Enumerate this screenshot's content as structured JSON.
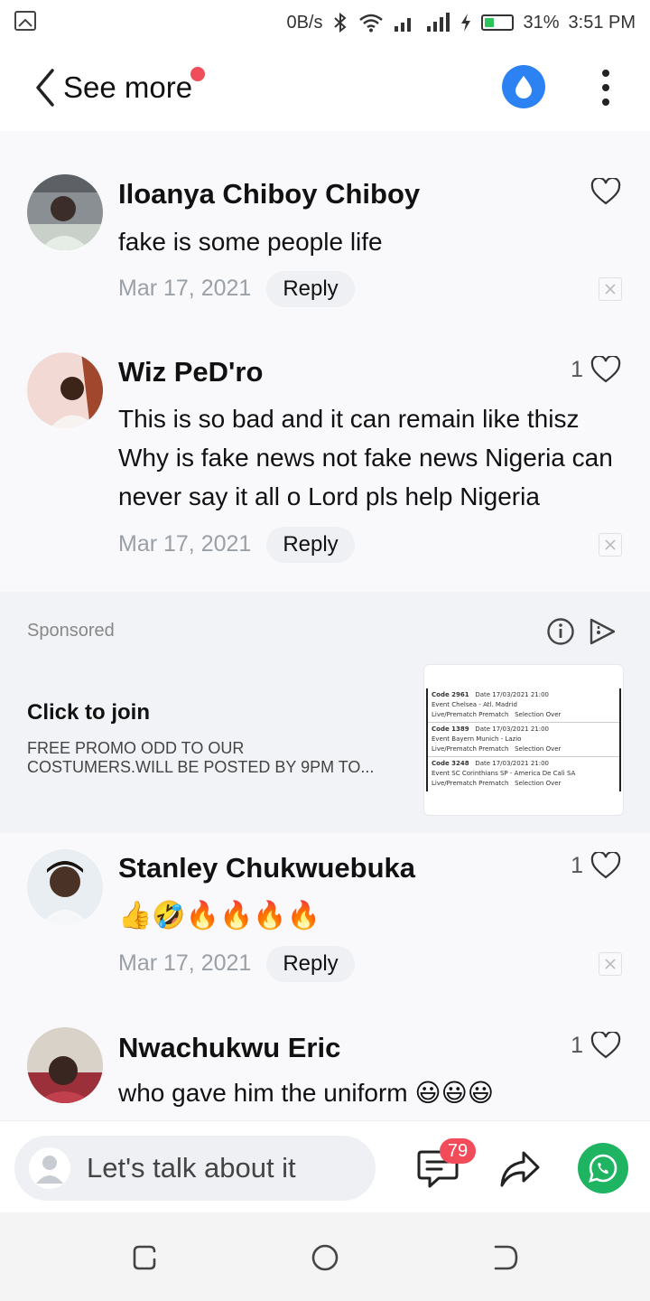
{
  "status_bar": {
    "net_speed": "0B/s",
    "battery_percent": "31%",
    "time": "3:51 PM",
    "battery_level": 0.31,
    "battery_color": "#2cc55b"
  },
  "header": {
    "back_icon": "chevron-left-icon",
    "title": "See more",
    "notification_dot_color": "#ee4e5a",
    "drop_icon": "water-drop-icon",
    "drop_button_color": "#2c82f2",
    "more_icon": "kebab-menu-icon"
  },
  "comments": [
    {
      "name": "Iloanya Chiboy Chiboy",
      "text": "fake is some people life",
      "date": "Mar 17, 2021",
      "reply_label": "Reply",
      "likes": ""
    },
    {
      "name": "Wiz PeD'ro",
      "text": "This is so bad and it can remain like thisz Why is fake news not fake news Nigeria can never say it all o Lord pls help Nigeria",
      "date": "Mar 17, 2021",
      "reply_label": "Reply",
      "likes": "1"
    },
    {
      "name": "Stanley Chukwuebuka",
      "text": "👍🤣🔥🔥🔥🔥",
      "date": "Mar 17, 2021",
      "reply_label": "Reply",
      "likes": "1"
    },
    {
      "name": "Nwachukwu Eric",
      "text": "who gave him the uniform 😃😃😃",
      "date": "",
      "reply_label": "",
      "likes": "1"
    }
  ],
  "ad": {
    "sponsored_label": "Sponsored",
    "title": "Click to join",
    "description": "FREE PROMO ODD TO OUR COSTUMERS.WILL BE POSTED BY 9PM TO...",
    "thumb_rows": [
      {
        "code": "Code  2961",
        "date": "Date  17/03/2021 21:00",
        "event": "Event  Chelsea - Atl. Madrid",
        "live": "Live/Prematch  Prematch",
        "selection": "Selection  Over"
      },
      {
        "code": "Code  1389",
        "date": "Date  17/03/2021 21:00",
        "event": "Event  Bayern Munich - Lazio",
        "live": "Live/Prematch  Prematch",
        "selection": "Selection  Over"
      },
      {
        "code": "Code  3248",
        "date": "Date  17/03/2021 21:00",
        "event": "Event  SC Corinthians SP - America De Cali SA",
        "live": "Live/Prematch  Prematch",
        "selection": "Selection  Over"
      }
    ]
  },
  "bottom_bar": {
    "input_placeholder": "Let's talk about it",
    "comment_count_badge": "79",
    "badge_color": "#f24c5b",
    "whatsapp_color": "#1fb462"
  }
}
